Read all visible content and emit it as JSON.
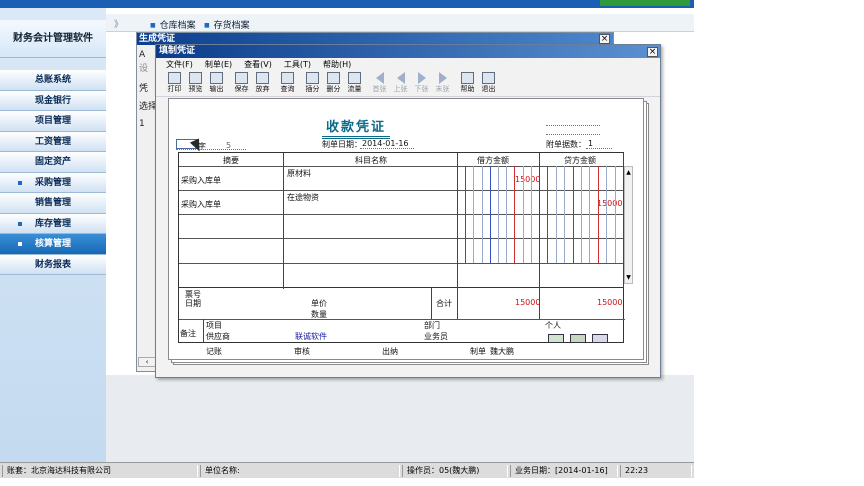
{
  "app": {
    "brand": "财务会计管理软件"
  },
  "sidebar": {
    "items": [
      {
        "label": "总账系统",
        "dot": false,
        "active": false
      },
      {
        "label": "现金银行",
        "dot": false,
        "active": false
      },
      {
        "label": "项目管理",
        "dot": false,
        "active": false
      },
      {
        "label": "工资管理",
        "dot": false,
        "active": false
      },
      {
        "label": "固定资产",
        "dot": false,
        "active": false
      },
      {
        "label": "采购管理",
        "dot": true,
        "active": false
      },
      {
        "label": "销售管理",
        "dot": false,
        "active": false
      },
      {
        "label": "库存管理",
        "dot": true,
        "active": false
      },
      {
        "label": "核算管理",
        "dot": true,
        "active": true
      },
      {
        "label": "财务报表",
        "dot": false,
        "active": false
      }
    ]
  },
  "tabs": {
    "arrow": "》",
    "items": [
      "仓库档案",
      "存货档案"
    ]
  },
  "outer_window": {
    "title": "生成凭证",
    "cut_labels": [
      "A",
      "设",
      "凭",
      "选择",
      "1"
    ]
  },
  "inner_window": {
    "title": "填制凭证",
    "menu": [
      "文件(F)",
      "制单(E)",
      "查看(V)",
      "工具(T)",
      "帮助(H)"
    ],
    "toolbar": [
      {
        "label": "打印",
        "icon": "print-icon",
        "dis": false
      },
      {
        "label": "预览",
        "icon": "preview-icon",
        "dis": false
      },
      {
        "label": "输出",
        "icon": "export-icon",
        "dis": false
      },
      {
        "label": "保存",
        "icon": "save-icon",
        "dis": false
      },
      {
        "label": "放弃",
        "icon": "undo-icon",
        "dis": false
      },
      {
        "label": "查询",
        "icon": "binoculars-icon",
        "dis": false
      },
      {
        "label": "插分",
        "icon": "insert-entry-icon",
        "dis": false
      },
      {
        "label": "删分",
        "icon": "delete-entry-icon",
        "dis": false
      },
      {
        "label": "流量",
        "icon": "cashflow-icon",
        "dis": false
      },
      {
        "label": "首张",
        "icon": "first-icon",
        "dis": true
      },
      {
        "label": "上张",
        "icon": "prev-icon",
        "dis": true
      },
      {
        "label": "下张",
        "icon": "next-icon",
        "dis": true
      },
      {
        "label": "末张",
        "icon": "last-icon",
        "dis": true
      },
      {
        "label": "帮助",
        "icon": "help-icon",
        "dis": false
      },
      {
        "label": "退出",
        "icon": "exit-icon",
        "dis": false
      }
    ]
  },
  "voucher": {
    "title": "收款凭证",
    "zi_label": "字",
    "number": "5",
    "date_label": "制单日期：",
    "date": "2014-01-16",
    "attach_label": "附单据数：",
    "attach": "1",
    "headers": {
      "summary": "摘要",
      "account": "科目名称",
      "debit": "借方金额",
      "credit": "贷方金额"
    },
    "rows": [
      {
        "summary": "采购入库单",
        "account": "原材料",
        "debit": "15000",
        "credit": ""
      },
      {
        "summary": "采购入库单",
        "account": "在途物资",
        "debit": "",
        "credit": "15000"
      }
    ],
    "footer": {
      "ticket_no": "票号",
      "date": "日期",
      "unit_price": "单价",
      "quantity": "数量",
      "total_label": "合计",
      "total_debit": "15000",
      "total_credit": "15000",
      "remark": "备注",
      "project": "项目",
      "supplier": "供应商",
      "supplier_value": "联诚软件",
      "department": "部门",
      "salesperson": "业务员",
      "person": "个人"
    },
    "sign": {
      "bookkeeper": "记账",
      "reviewer": "审核",
      "cashier": "出纳",
      "maker": "制单",
      "maker_name": "魏大鹏"
    }
  },
  "statusbar": {
    "account": "账套：北京海达科技有限公司",
    "unit": "单位名称:",
    "operator": "操作员：05(魏大鹏)",
    "business_date": "业务日期：[2014-01-16]",
    "time": "22:23"
  }
}
